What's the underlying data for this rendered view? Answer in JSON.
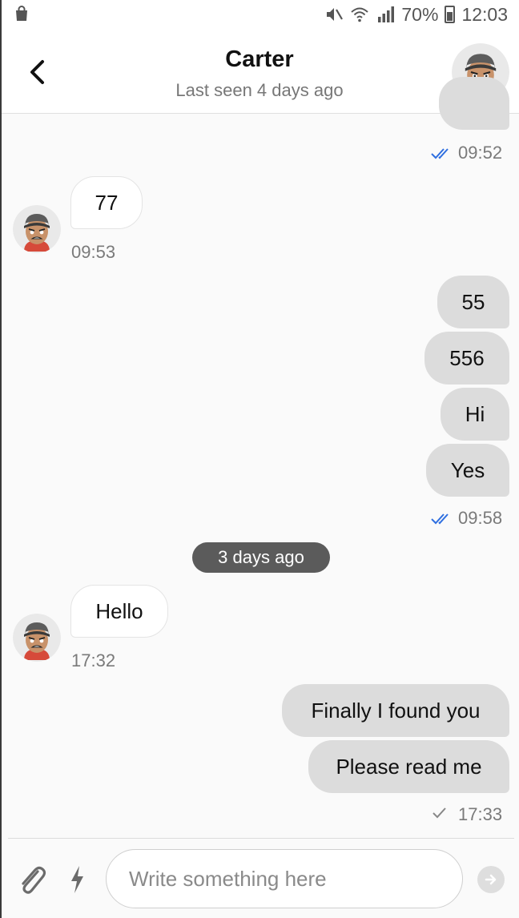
{
  "status_bar": {
    "battery": "70%",
    "clock": "12:03",
    "icons": [
      "shopping-bag-icon",
      "mute-icon",
      "wifi-icon",
      "signal-icon",
      "battery-icon"
    ]
  },
  "header": {
    "contact_name": "Carter",
    "last_seen": "Last seen 4 days ago",
    "back_icon": "back-chevron-icon"
  },
  "messages": {
    "group1": {
      "time": "09:52",
      "status": "read"
    },
    "m77": {
      "text": "77",
      "time": "09:53"
    },
    "out_group2": {
      "items": [
        "55",
        "556",
        "Hi",
        "Yes"
      ],
      "time": "09:58",
      "status": "read"
    },
    "date_divider": "3 days ago",
    "hello": {
      "text": "Hello",
      "time": "17:32"
    },
    "out_group3": {
      "items": [
        "Finally I found you",
        "Please read me"
      ],
      "time": "17:33",
      "status": "sent"
    }
  },
  "composer": {
    "placeholder": "Write something here",
    "attach_icon": "paperclip-icon",
    "quick_icon": "lightning-icon",
    "send_icon": "send-arrow-icon"
  },
  "colors": {
    "read_tick": "#2f6fe0",
    "outgoing_bubble": "#dcdcdc",
    "divider_pill": "#5b5b5b"
  }
}
